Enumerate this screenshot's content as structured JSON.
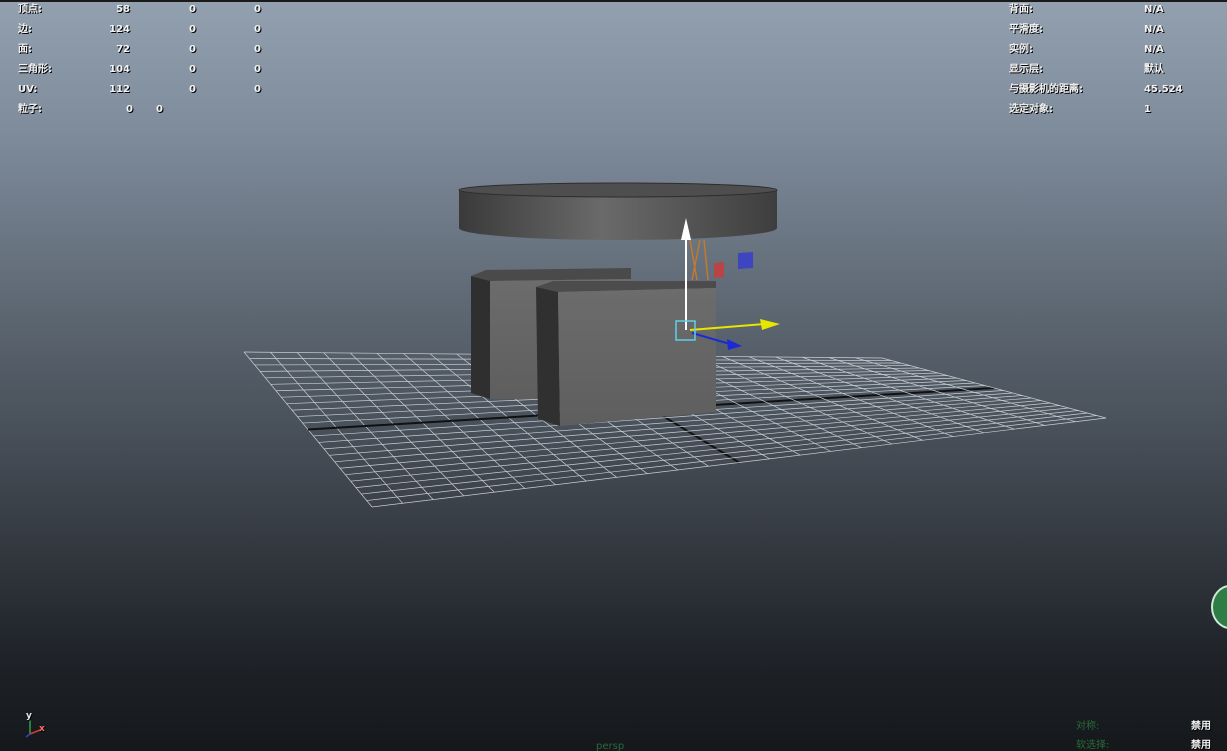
{
  "hud_left": {
    "rows": [
      {
        "label": "顶点:",
        "vals": [
          "58",
          "0",
          "0"
        ]
      },
      {
        "label": "边:",
        "vals": [
          "124",
          "0",
          "0"
        ]
      },
      {
        "label": "面:",
        "vals": [
          "72",
          "0",
          "0"
        ]
      },
      {
        "label": "三角形:",
        "vals": [
          "104",
          "0",
          "0"
        ]
      },
      {
        "label": "UV:",
        "vals": [
          "112",
          "0",
          "0"
        ]
      },
      {
        "label": "粒子:",
        "vals": [
          "0",
          "0"
        ]
      }
    ]
  },
  "hud_right": {
    "rows": [
      {
        "label": "背面:",
        "value": "N/A"
      },
      {
        "label": "平滑度:",
        "value": "N/A"
      },
      {
        "label": "实例:",
        "value": "N/A"
      },
      {
        "label": "显示层:",
        "value": "默认"
      },
      {
        "label": "与摄影机的距离:",
        "value": "45.524"
      },
      {
        "label": "选定对象:",
        "value": "1"
      }
    ]
  },
  "hud_bottom": {
    "camera": "persp",
    "symmetry_label": "对称:",
    "symmetry_value": "禁用",
    "soft_select_label": "软选择:",
    "soft_select_value": "禁用"
  },
  "axis_labels": {
    "y": "y",
    "x": "x"
  },
  "colors": {
    "hud_text": "#f2f2f2",
    "gizmo_y": "#ffffff",
    "gizmo_x": "#e6e600",
    "gizmo_z": "#1a2bd6",
    "gizmo_center": "#5fd0e8",
    "mesh_gray": "#6b6b6b"
  },
  "icons": [
    "view-axis-icon",
    "move-manipulator-icon",
    "view-cube-icon"
  ]
}
